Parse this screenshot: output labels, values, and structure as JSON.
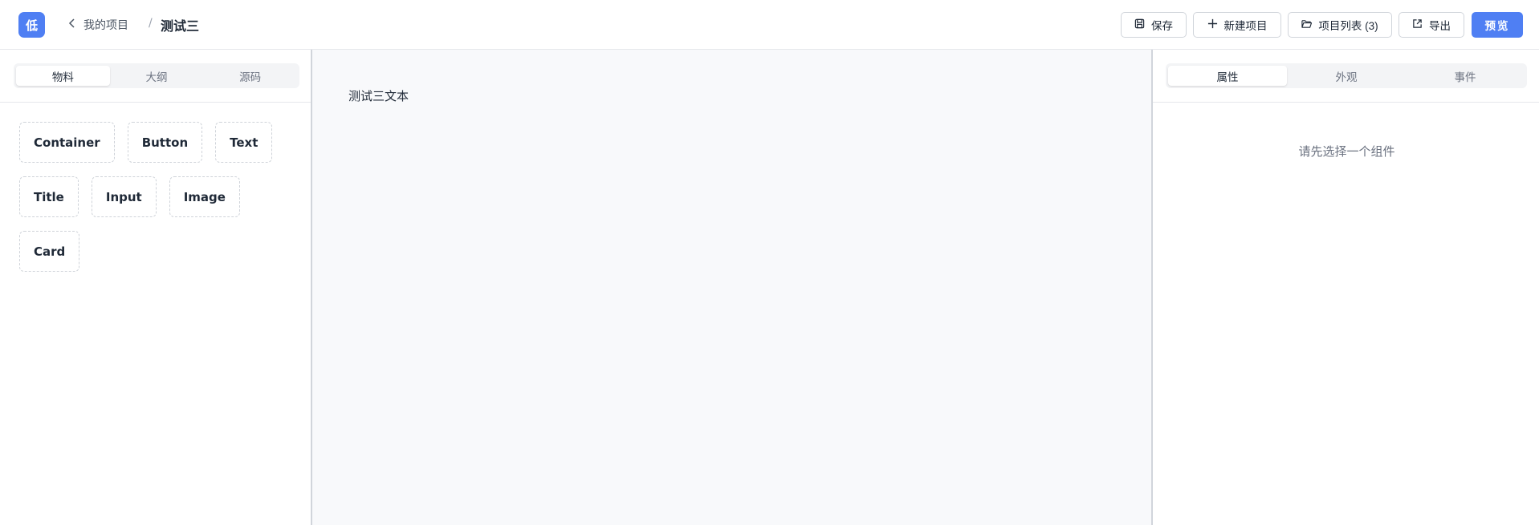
{
  "header": {
    "logo_text": "低",
    "back_label": "我的项目",
    "separator": "/",
    "project_title": "测试三",
    "buttons": {
      "save": "保存",
      "new_project": "新建项目",
      "project_list": "项目列表 (3)",
      "export": "导出",
      "preview": "预览"
    }
  },
  "left_panel": {
    "tabs": [
      {
        "label": "物料",
        "active": true
      },
      {
        "label": "大纲",
        "active": false
      },
      {
        "label": "源码",
        "active": false
      }
    ],
    "materials": [
      "Container",
      "Button",
      "Text",
      "Title",
      "Input",
      "Image",
      "Card"
    ]
  },
  "canvas": {
    "text": "测试三文本"
  },
  "right_panel": {
    "tabs": [
      {
        "label": "属性",
        "active": true
      },
      {
        "label": "外观",
        "active": false
      },
      {
        "label": "事件",
        "active": false
      }
    ],
    "placeholder": "请先选择一个组件"
  },
  "colors": {
    "accent": "#4f7ff3",
    "border": "#e5e7eb",
    "canvas_bg": "#f8f9fb"
  }
}
